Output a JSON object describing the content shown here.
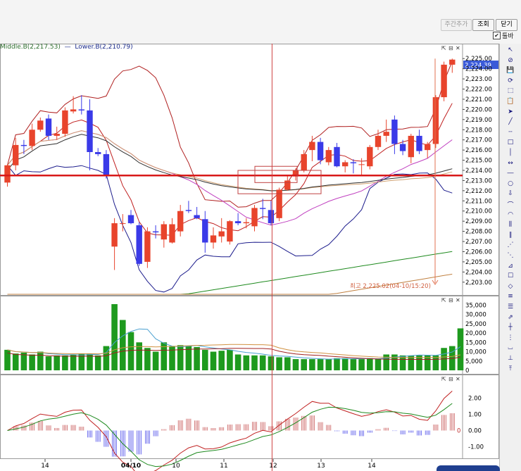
{
  "toolbar": {
    "btn_disabled_label": "주간추가",
    "btn_query_label": "조회",
    "btn_close_label": "닫기",
    "toolbox_label": "툴바",
    "toolbox_checked": true
  },
  "legend": {
    "middle": "Middle.B(2,217.53)",
    "lower": "Lower.B(2,210.79)"
  },
  "price_panel": {
    "last_price_label": "2,224.39",
    "high_note": "최고 2,225.02(04-10/15:20)",
    "ticks": [
      "2,225.00",
      "2,224.00",
      "2,223.00",
      "2,222.00",
      "2,221.00",
      "2,220.00",
      "2,219.00",
      "2,218.00",
      "2,217.00",
      "2,216.00",
      "2,215.00",
      "2,214.00",
      "2,213.00",
      "2,212.00",
      "2,211.00",
      "2,210.00",
      "2,209.00",
      "2,208.00",
      "2,207.00",
      "2,206.00",
      "2,205.00",
      "2,204.00",
      "2,203.00"
    ]
  },
  "volume_panel": {
    "ticks": [
      "35,000",
      "30,000",
      "25,000",
      "20,000",
      "15,000",
      "10,000",
      "5,000",
      "0"
    ]
  },
  "macd_panel": {
    "ticks": [
      "2.00",
      "1.00",
      "0.00",
      "-1.00"
    ],
    "zero_label": "0"
  },
  "x_axis": {
    "labels": [
      "14",
      "04/10",
      "10",
      "11",
      "12",
      "13",
      "14"
    ]
  },
  "colors": {
    "up": "#e8442c",
    "down": "#3a3ae8",
    "volume": "#1e9a1e",
    "resistance": "#d81818",
    "crosshair": "#d04040"
  },
  "chart_data": {
    "type": "candlestick",
    "price_range": [
      2202.5,
      2225.5
    ],
    "candles": [
      [
        2212.8,
        2214.6,
        2212.4,
        2214.5
      ],
      [
        2214.5,
        2217.2,
        2214.0,
        2216.5
      ],
      [
        2216.5,
        2217.0,
        2215.6,
        2216.4
      ],
      [
        2216.4,
        2218.6,
        2216.0,
        2218.0
      ],
      [
        2218.0,
        2219.2,
        2217.8,
        2218.9
      ],
      [
        2219.1,
        2219.5,
        2217.0,
        2217.4
      ],
      [
        2217.4,
        2218.3,
        2217.0,
        2217.6
      ],
      [
        2217.6,
        2220.2,
        2217.3,
        2219.9
      ],
      [
        2219.8,
        2221.3,
        2219.6,
        2220.0
      ],
      [
        2220.0,
        2221.4,
        2219.5,
        2219.9
      ],
      [
        2219.9,
        2221.0,
        2214.0,
        2215.8
      ],
      [
        2215.8,
        2216.2,
        2215.4,
        2215.6
      ],
      [
        2215.6,
        2216.0,
        2213.2,
        2213.5
      ],
      [
        2206.5,
        2209.3,
        2204.2,
        2208.8
      ],
      [
        2208.8,
        2209.7,
        2208.0,
        2208.8
      ],
      [
        2209.6,
        2210.1,
        2208.7,
        2208.8
      ],
      [
        2208.6,
        2208.9,
        2204.6,
        2204.8
      ],
      [
        2205.0,
        2208.4,
        2204.4,
        2208.0
      ],
      [
        2208.0,
        2208.6,
        2207.3,
        2207.9
      ],
      [
        2207.2,
        2209.0,
        2206.4,
        2208.7
      ],
      [
        2206.9,
        2209.3,
        2206.8,
        2208.7
      ],
      [
        2208.0,
        2210.6,
        2207.5,
        2210.0
      ],
      [
        2210.1,
        2211.0,
        2209.8,
        2210.0
      ],
      [
        2209.6,
        2210.4,
        2209.2,
        2209.3
      ],
      [
        2209.2,
        2210.0,
        2205.9,
        2206.9
      ],
      [
        2206.9,
        2208.4,
        2206.3,
        2207.6
      ],
      [
        2207.5,
        2209.3,
        2206.9,
        2208.0
      ],
      [
        2207.0,
        2209.1,
        2206.7,
        2209.0
      ],
      [
        2209.0,
        2209.8,
        2208.6,
        2208.8
      ],
      [
        2208.8,
        2209.3,
        2208.3,
        2208.9
      ],
      [
        2208.5,
        2210.6,
        2208.0,
        2210.3
      ],
      [
        2210.3,
        2211.2,
        2209.2,
        2210.2
      ],
      [
        2210.1,
        2211.0,
        2208.6,
        2208.8
      ],
      [
        2209.3,
        2212.3,
        2209.0,
        2212.1
      ],
      [
        2212.1,
        2213.5,
        2212.0,
        2213.0
      ],
      [
        2213.4,
        2214.2,
        2213.0,
        2214.0
      ],
      [
        2214.0,
        2216.0,
        2213.8,
        2215.6
      ],
      [
        2216.0,
        2217.4,
        2214.9,
        2216.8
      ],
      [
        2216.8,
        2217.2,
        2214.6,
        2215.0
      ],
      [
        2214.8,
        2216.3,
        2214.5,
        2216.0
      ],
      [
        2216.3,
        2216.7,
        2214.3,
        2214.4
      ],
      [
        2214.4,
        2215.0,
        2213.8,
        2214.8
      ],
      [
        2214.8,
        2215.1,
        2213.7,
        2214.7
      ],
      [
        2214.6,
        2215.2,
        2213.5,
        2214.6
      ],
      [
        2214.4,
        2216.5,
        2214.1,
        2216.3
      ],
      [
        2216.3,
        2218.0,
        2216.0,
        2217.4
      ],
      [
        2217.4,
        2219.0,
        2216.8,
        2217.8
      ],
      [
        2219.0,
        2219.4,
        2215.6,
        2216.6
      ],
      [
        2216.6,
        2217.0,
        2215.5,
        2215.9
      ],
      [
        2215.3,
        2217.6,
        2214.7,
        2217.4
      ],
      [
        2217.4,
        2218.0,
        2215.6,
        2215.9
      ],
      [
        2216.0,
        2216.8,
        2215.2,
        2216.6
      ],
      [
        2216.6,
        2221.4,
        2216.2,
        2221.2
      ],
      [
        2221.2,
        2224.7,
        2220.8,
        2224.4
      ],
      [
        2224.4,
        2225.0,
        2223.6,
        2224.9
      ]
    ],
    "volume_range": [
      0,
      37000
    ],
    "volumes": [
      11000,
      9000,
      9500,
      8500,
      10000,
      7500,
      8000,
      8000,
      8500,
      9000,
      9000,
      8000,
      13000,
      35500,
      27000,
      20500,
      15000,
      12000,
      10000,
      15000,
      13000,
      13500,
      13000,
      12500,
      11000,
      10000,
      10500,
      11000,
      8500,
      8000,
      8000,
      8000,
      7500,
      7000,
      7000,
      6000,
      6000,
      6000,
      6000,
      6000,
      6500,
      6500,
      6000,
      6000,
      6500,
      6000,
      8500,
      8500,
      8000,
      8000,
      8000,
      8000,
      8000,
      12000,
      13000,
      22500
    ],
    "macd_range": [
      -1.5,
      3.2
    ]
  }
}
